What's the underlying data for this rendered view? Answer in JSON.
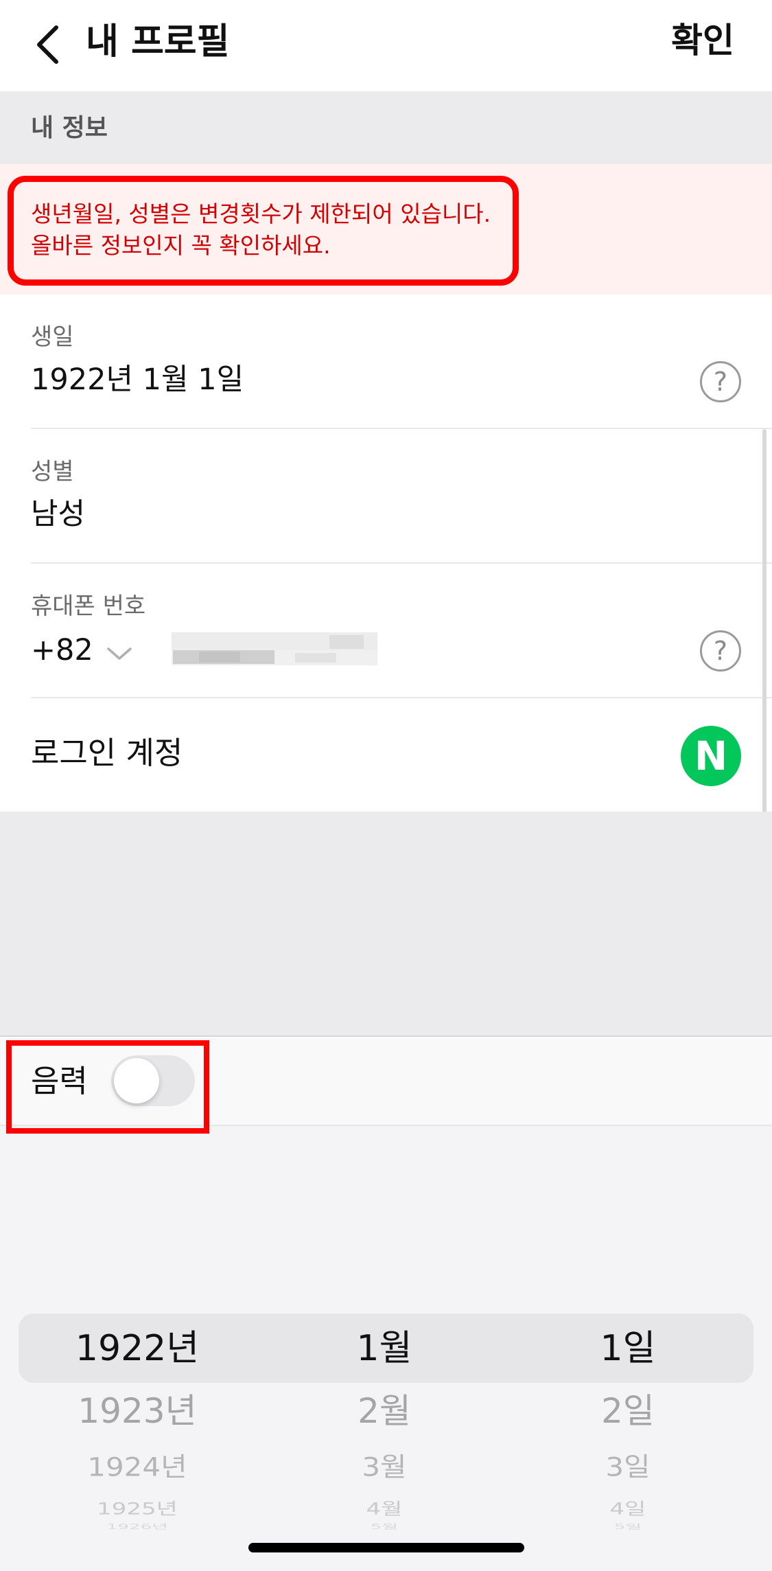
{
  "header": {
    "title": "내 프로필",
    "confirm_label": "확인"
  },
  "section": {
    "title": "내 정보"
  },
  "warning": {
    "line1": "생년월일, 성별은 변경횟수가 제한되어 있습니다.",
    "line2": "올바른 정보인지 꼭 확인하세요."
  },
  "fields": {
    "birthday": {
      "label": "생일",
      "value": "1922년 1월 1일"
    },
    "gender": {
      "label": "성별",
      "value": "남성"
    },
    "phone": {
      "label": "휴대폰 번호",
      "country_code": "+82"
    },
    "login": {
      "label": "로그인 계정",
      "provider_badge": "N"
    }
  },
  "picker": {
    "lunar_label": "음력",
    "lunar_enabled": false,
    "years": [
      "1922년",
      "1923년",
      "1924년",
      "1925년",
      "1926년"
    ],
    "months": [
      "1월",
      "2월",
      "3월",
      "4월",
      "5월"
    ],
    "days": [
      "1일",
      "2일",
      "3일",
      "4일",
      "5일"
    ]
  },
  "colors": {
    "warning_text": "#d40000",
    "warning_background": "#fff1f0",
    "annotation_red": "#ff0000",
    "naver_green": "#03c75a"
  },
  "icons": {
    "back": "chevron-left-icon",
    "help": "question-circle-icon",
    "dropdown": "chevron-down-icon",
    "login_provider": "naver-logo-icon"
  }
}
